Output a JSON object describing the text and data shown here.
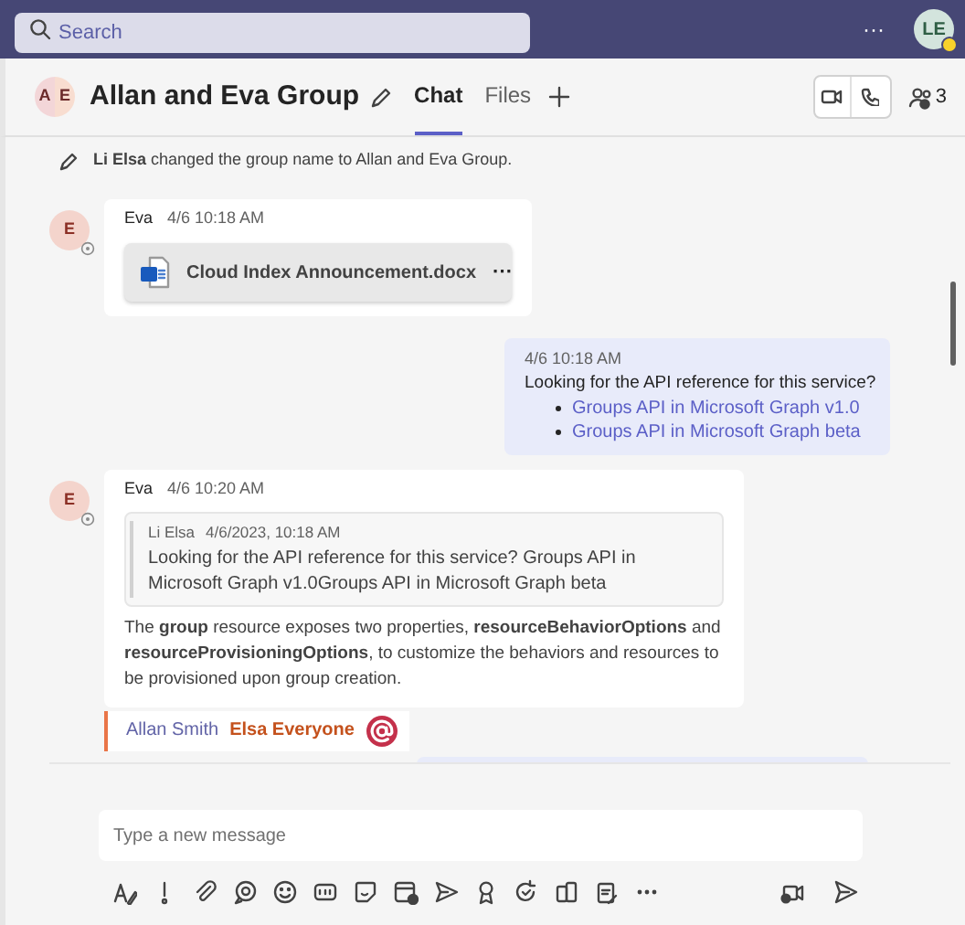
{
  "search": {
    "placeholder": "Search"
  },
  "top_bar": {
    "more": "···",
    "avatar_initials": "LE",
    "away": true
  },
  "header": {
    "avatar_initials": [
      "A",
      "E"
    ],
    "title": "Allan and Eva Group",
    "tabs": [
      {
        "label": "Chat",
        "selected": true
      },
      {
        "label": "Files",
        "selected": false
      }
    ],
    "participants_count": "3"
  },
  "system_message": "**Li Elsa** changed the group name to Allan and Eva Group.",
  "messages": [
    {
      "kind": "file",
      "avatar": "E",
      "sender": "Eva",
      "time": "4/6 10:18 AM",
      "file_name": "Cloud Index Announcement.docx",
      "file_more": "···"
    },
    {
      "kind": "links",
      "time": "4/6 10:18 AM",
      "text": "Looking for the API reference for this service?",
      "links": [
        "Groups API in Microsoft Graph v1.0",
        "Groups API in Microsoft Graph beta"
      ]
    },
    {
      "kind": "reply",
      "avatar": "E",
      "sender": "Eva",
      "time": "4/6 10:20 AM",
      "quote": {
        "sender": "Li Elsa",
        "time": "4/6/2023, 10:18 AM",
        "text": "Looking for the API reference for this service? Groups API in Microsoft Graph v1.0Groups API in Microsoft Graph beta"
      },
      "text": "The **group** resource exposes two properties, **resourceBehaviorOptions** and **resourceProvisioningOptions**, to customize the behaviors and resources to be provisioned upon group creation."
    }
  ],
  "mentions": [
    {
      "kind": "person",
      "label": "Allan Smith"
    },
    {
      "kind": "everyone",
      "label": "Elsa Everyone"
    }
  ],
  "compose": {
    "placeholder": "Type a new message"
  }
}
